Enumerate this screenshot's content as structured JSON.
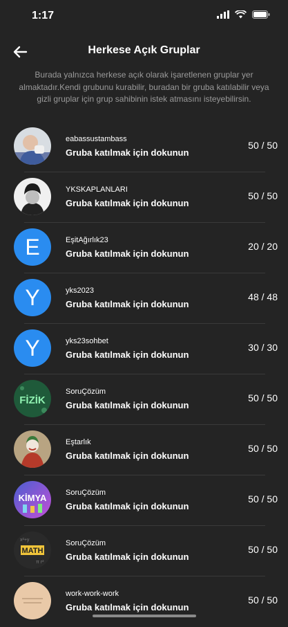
{
  "status": {
    "time": "1:17"
  },
  "header": {
    "title": "Herkese Açık Gruplar"
  },
  "description": "Burada yalnızca herkese açık olarak işaretlenen gruplar yer almaktadır.Kendi grubunu kurabilir, buradan bir gruba katılabilir veya gizli gruplar için grup sahibinin istek atmasını isteyebilirsin.",
  "groups": [
    {
      "name": "eabassustambass",
      "subtitle": "Gruba katılmak için dokunun",
      "count": "50 / 50",
      "avatar": "photo-man-icon"
    },
    {
      "name": "YKSKAPLANLARI",
      "subtitle": "Gruba katılmak için dokunun",
      "count": "50 / 50",
      "avatar": "photo-portrait-icon"
    },
    {
      "name": "EşitAğırlık23",
      "subtitle": "Gruba katılmak için dokunun",
      "count": "20 / 20",
      "avatar": "letter-avatar",
      "letter": "E"
    },
    {
      "name": "yks2023",
      "subtitle": "Gruba katılmak için dokunun",
      "count": "48 / 48",
      "avatar": "letter-avatar",
      "letter": "Y"
    },
    {
      "name": "yks23sohbet",
      "subtitle": "Gruba katılmak için dokunun",
      "count": "30 / 30",
      "avatar": "letter-avatar",
      "letter": "Y"
    },
    {
      "name": "SoruÇözüm",
      "subtitle": "Gruba katılmak için dokunun",
      "count": "50 / 50",
      "avatar": "fizik-icon",
      "label": "FİZİK"
    },
    {
      "name": "Eştarlık",
      "subtitle": "Gruba katılmak için dokunun",
      "count": "50 / 50",
      "avatar": "joker-icon"
    },
    {
      "name": "SoruÇözüm",
      "subtitle": "Gruba katılmak için dokunun",
      "count": "50 / 50",
      "avatar": "kimya-icon",
      "label": "KİMYA"
    },
    {
      "name": "SoruÇözüm",
      "subtitle": "Gruba katılmak için dokunun",
      "count": "50 / 50",
      "avatar": "math-icon",
      "label": "MATH"
    },
    {
      "name": "work-work-work",
      "subtitle": "Gruba katılmak için dokunun",
      "count": "50 / 50",
      "avatar": "note-icon"
    }
  ],
  "colors": {
    "background": "#242424",
    "accent": "#2a8cf0",
    "muted": "#9a9a9a"
  }
}
